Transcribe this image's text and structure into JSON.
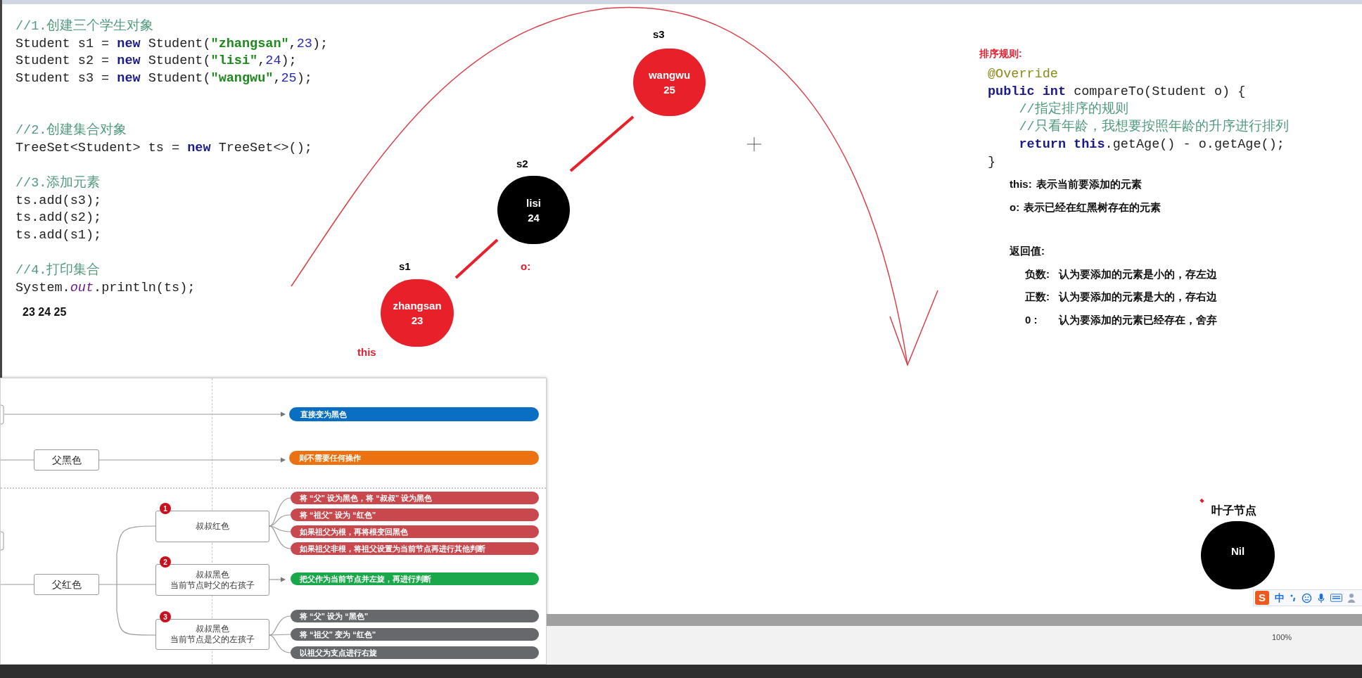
{
  "code_panel": {
    "blocks": [
      {
        "lines": [
          [
            {
              "kind": "comment",
              "text": "//1.创建三个学生对象"
            }
          ],
          [
            {
              "kind": "plain",
              "text": "Student s1 = "
            },
            {
              "kind": "keyword",
              "text": "new"
            },
            {
              "kind": "plain",
              "text": " Student("
            },
            {
              "kind": "string",
              "text": "\"zhangsan\""
            },
            {
              "kind": "plain",
              "text": ","
            },
            {
              "kind": "number",
              "text": "23"
            },
            {
              "kind": "plain",
              "text": ");"
            }
          ],
          [
            {
              "kind": "plain",
              "text": "Student s2 = "
            },
            {
              "kind": "keyword",
              "text": "new"
            },
            {
              "kind": "plain",
              "text": " Student("
            },
            {
              "kind": "string",
              "text": "\"lisi\""
            },
            {
              "kind": "plain",
              "text": ","
            },
            {
              "kind": "number",
              "text": "24"
            },
            {
              "kind": "plain",
              "text": ");"
            }
          ],
          [
            {
              "kind": "plain",
              "text": "Student s3 = "
            },
            {
              "kind": "keyword",
              "text": "new"
            },
            {
              "kind": "plain",
              "text": " Student("
            },
            {
              "kind": "string",
              "text": "\"wangwu\""
            },
            {
              "kind": "plain",
              "text": ","
            },
            {
              "kind": "number",
              "text": "25"
            },
            {
              "kind": "plain",
              "text": ");"
            }
          ]
        ]
      },
      {
        "lines": [
          [
            {
              "kind": "comment",
              "text": "//2.创建集合对象"
            }
          ],
          [
            {
              "kind": "plain",
              "text": "TreeSet<Student> ts = "
            },
            {
              "kind": "keyword",
              "text": "new"
            },
            {
              "kind": "plain",
              "text": " TreeSet<>();"
            }
          ]
        ]
      },
      {
        "lines": [
          [
            {
              "kind": "comment",
              "text": "//3.添加元素"
            }
          ],
          [
            {
              "kind": "plain",
              "text": "ts.add(s3);"
            }
          ],
          [
            {
              "kind": "plain",
              "text": "ts.add(s2);"
            }
          ],
          [
            {
              "kind": "plain",
              "text": "ts.add(s1);"
            }
          ]
        ]
      },
      {
        "lines": [
          [
            {
              "kind": "comment",
              "text": "//4.打印集合"
            }
          ],
          [
            {
              "kind": "plain",
              "text": "System."
            },
            {
              "kind": "field",
              "text": "out"
            },
            {
              "kind": "plain",
              "text": ".println(ts);"
            }
          ]
        ]
      }
    ],
    "output": "23 24 25"
  },
  "tree": {
    "nodes": [
      {
        "label": "s3",
        "name": "wangwu",
        "age": "25",
        "color": "#e8202a"
      },
      {
        "label": "s2",
        "name": "lisi",
        "age": "24",
        "color": "#000000"
      },
      {
        "label": "s1",
        "name": "zhangsan",
        "age": "23",
        "color": "#e8202a"
      }
    ],
    "annotations": [
      "o:",
      "this"
    ]
  },
  "rule_panel": {
    "title": "排序规则:",
    "code": [
      [
        {
          "kind": "annotation",
          "text": "@Override"
        }
      ],
      [
        {
          "kind": "keyword",
          "text": "public int"
        },
        {
          "kind": "plain",
          "text": " compareTo(Student o) {"
        }
      ],
      [
        {
          "kind": "comment",
          "text": "    //指定排序的规则"
        }
      ],
      [
        {
          "kind": "comment",
          "text": "    //只看年龄，我想要按照年龄的升序进行排列"
        }
      ],
      [
        {
          "kind": "keyword",
          "text": "    return this"
        },
        {
          "kind": "plain",
          "text": ".getAge() - o.getAge();"
        }
      ],
      [
        {
          "kind": "plain",
          "text": "}"
        }
      ]
    ],
    "params": [
      {
        "label": "this:",
        "text": "表示当前要添加的元素"
      },
      {
        "label": "o:",
        "text": "表示已经在红黑树存在的元素"
      }
    ],
    "return_title": "返回值:",
    "returns": [
      {
        "label": "负数:",
        "text": "认为要添加的元素是小的，存左边"
      },
      {
        "label": "正数:",
        "text": "认为要添加的元素是大的，存右边"
      },
      {
        "label": "0 :",
        "text": "认为要添加的元素已经存在，舍弃"
      }
    ]
  },
  "mind_map": {
    "top_action": {
      "text": "直接变为黑色",
      "color": "#0a6fc2"
    },
    "parent_black": {
      "label": "父黑色",
      "action": {
        "text": "则不需要任何操作",
        "color": "#ec7211"
      }
    },
    "parent_red": {
      "label": "父红色",
      "cases": [
        {
          "badge": "1",
          "lines": [
            "叔叔红色"
          ],
          "actions": [
            {
              "text": "将 “父” 设为黑色，将 “叔叔” 设为黑色",
              "color": "#c8484e"
            },
            {
              "text": "将 “祖父” 设为 “红色”",
              "color": "#c8484e"
            },
            {
              "text": "如果祖父为根，再将根变回黑色",
              "color": "#c8484e"
            },
            {
              "text": "如果祖父非根，将祖父设置为当前节点再进行其他判断",
              "color": "#c8484e"
            }
          ]
        },
        {
          "badge": "2",
          "lines": [
            "叔叔黑色",
            "当前节点时父的右孩子"
          ],
          "actions": [
            {
              "text": "把父作为当前节点并左旋，再进行判断",
              "color": "#1aa84a"
            }
          ]
        },
        {
          "badge": "3",
          "lines": [
            "叔叔黑色",
            "当前节点是父的左孩子"
          ],
          "actions": [
            {
              "text": "将 “父” 设为 “黑色”",
              "color": "#66686b"
            },
            {
              "text": "将 “祖父” 变为 “红色”",
              "color": "#66686b"
            },
            {
              "text": "以祖父为支点进行右旋",
              "color": "#66686b"
            }
          ]
        }
      ]
    }
  },
  "leaf": {
    "caption": "叶子节点",
    "name": "Nil"
  },
  "ime_toolbar": {
    "logo": "S",
    "mode": "中"
  },
  "zoom_level": "100%"
}
